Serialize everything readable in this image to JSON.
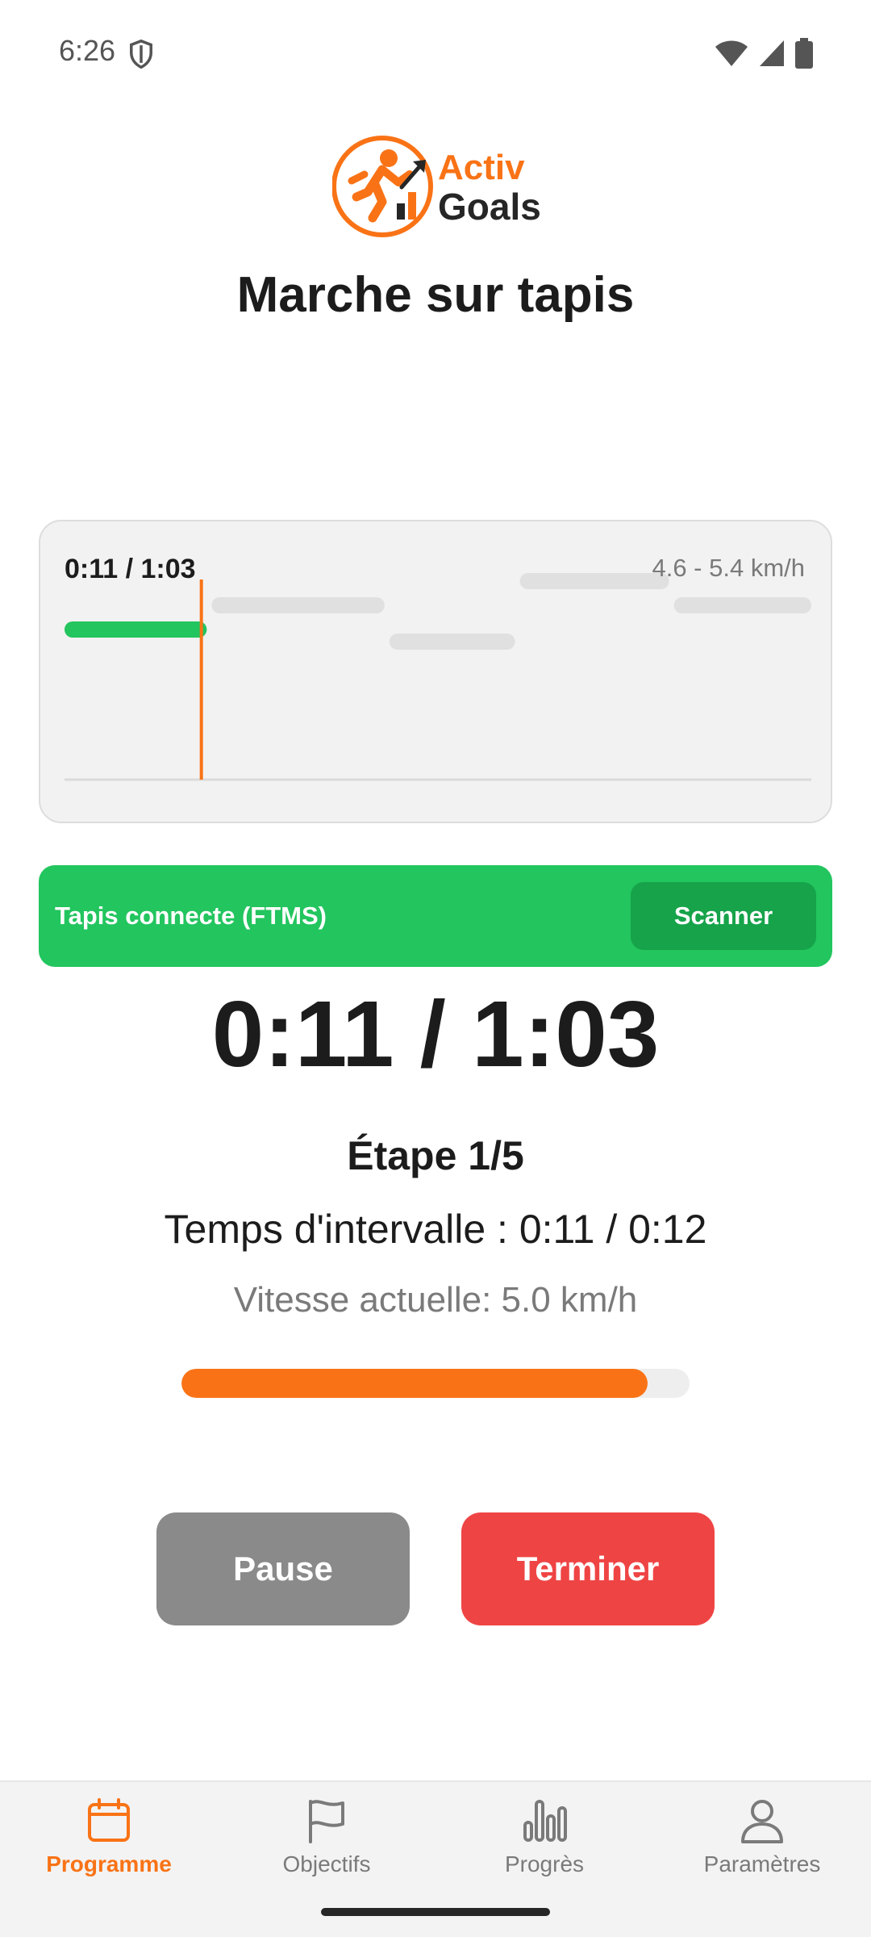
{
  "status_bar": {
    "time": "6:26",
    "icons": [
      "shield-icon",
      "wifi-icon",
      "cell-signal-icon",
      "battery-icon"
    ]
  },
  "logo": {
    "word1": "Activ",
    "word2": "Goals",
    "icon": "runner-icon",
    "colors": {
      "accent": "#f97316",
      "dark": "#262626"
    }
  },
  "page": {
    "title": "Marche sur tapis"
  },
  "chart": {
    "elapsed_label": "0:11 / 1:03",
    "speed_range": "4.6 - 5.4 km/h"
  },
  "chart_data": {
    "type": "bar",
    "title": "",
    "xlabel": "",
    "ylabel": "",
    "x_unit": "seconds",
    "y_unit": "km/h",
    "xlim": [
      0,
      63
    ],
    "ylim": [
      4.6,
      5.4
    ],
    "segments": [
      {
        "start": 0,
        "end": 12,
        "speed": 5.0
      },
      {
        "start": 12,
        "end": 27,
        "speed": 5.2
      },
      {
        "start": 27,
        "end": 38,
        "speed": 4.9
      },
      {
        "start": 38,
        "end": 51,
        "speed": 5.4
      },
      {
        "start": 51,
        "end": 63,
        "speed": 5.2
      }
    ],
    "current_time": 11,
    "completed_color": "#22c55e",
    "pending_color": "#e0e0e0",
    "cursor_color": "#f97316"
  },
  "connection": {
    "status_text": "Tapis connecte (FTMS)",
    "scan_label": "Scanner",
    "color": "#22c55e"
  },
  "session": {
    "timer": "0:11 / 1:03",
    "step": "Étape 1/5",
    "interval": "Temps d'intervalle : 0:11 / 0:12",
    "speed": "Vitesse actuelle: 5.0 km/h",
    "interval_progress": 0.917
  },
  "actions": {
    "pause_label": "Pause",
    "finish_label": "Terminer"
  },
  "nav": {
    "items": [
      {
        "label": "Programme",
        "icon": "calendar-icon",
        "active": true
      },
      {
        "label": "Objectifs",
        "icon": "flag-icon",
        "active": false
      },
      {
        "label": "Progrès",
        "icon": "bar-chart-icon",
        "active": false
      },
      {
        "label": "Paramètres",
        "icon": "person-icon",
        "active": false
      }
    ]
  }
}
